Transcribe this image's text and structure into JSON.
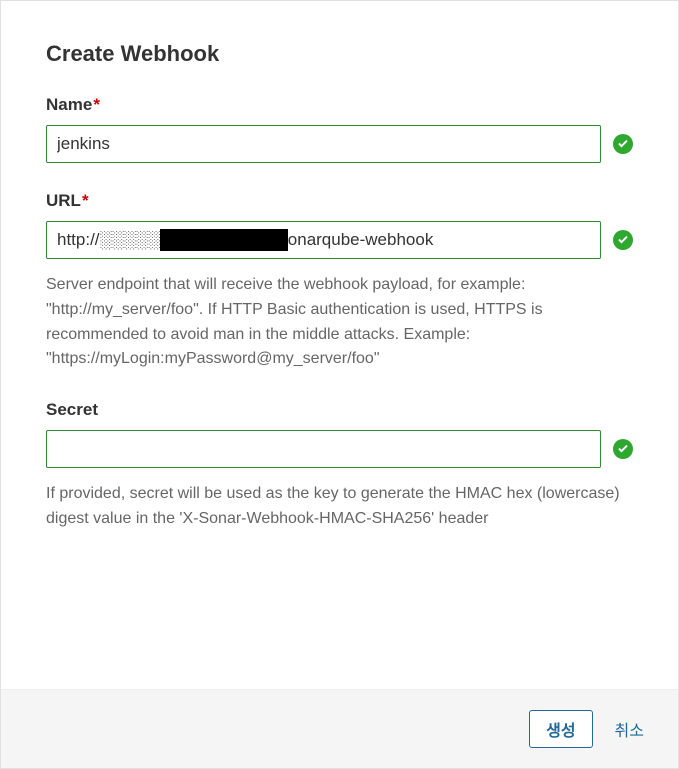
{
  "modal": {
    "title": "Create Webhook"
  },
  "form": {
    "name": {
      "label": "Name",
      "required": true,
      "value": "jenkins",
      "valid": true
    },
    "url": {
      "label": "URL",
      "required": true,
      "value": "http://░░░░░░░░░░░:9090/sonarqube-webhook",
      "value_prefix": "http://",
      "value_suffix": "9090/sonarqube-webhook",
      "valid": true,
      "help_text": "Server endpoint that will receive the webhook payload, for example: \"http://my_server/foo\". If HTTP Basic authentication is used, HTTPS is recommended to avoid man in the middle attacks. Example: \"https://myLogin:myPassword@my_server/foo\""
    },
    "secret": {
      "label": "Secret",
      "value": "",
      "valid": true,
      "help_text": "If provided, secret will be used as the key to generate the HMAC hex (lowercase) digest value in the 'X-Sonar-Webhook-HMAC-SHA256' header"
    }
  },
  "footer": {
    "submit_label": "생성",
    "cancel_label": "취소"
  }
}
